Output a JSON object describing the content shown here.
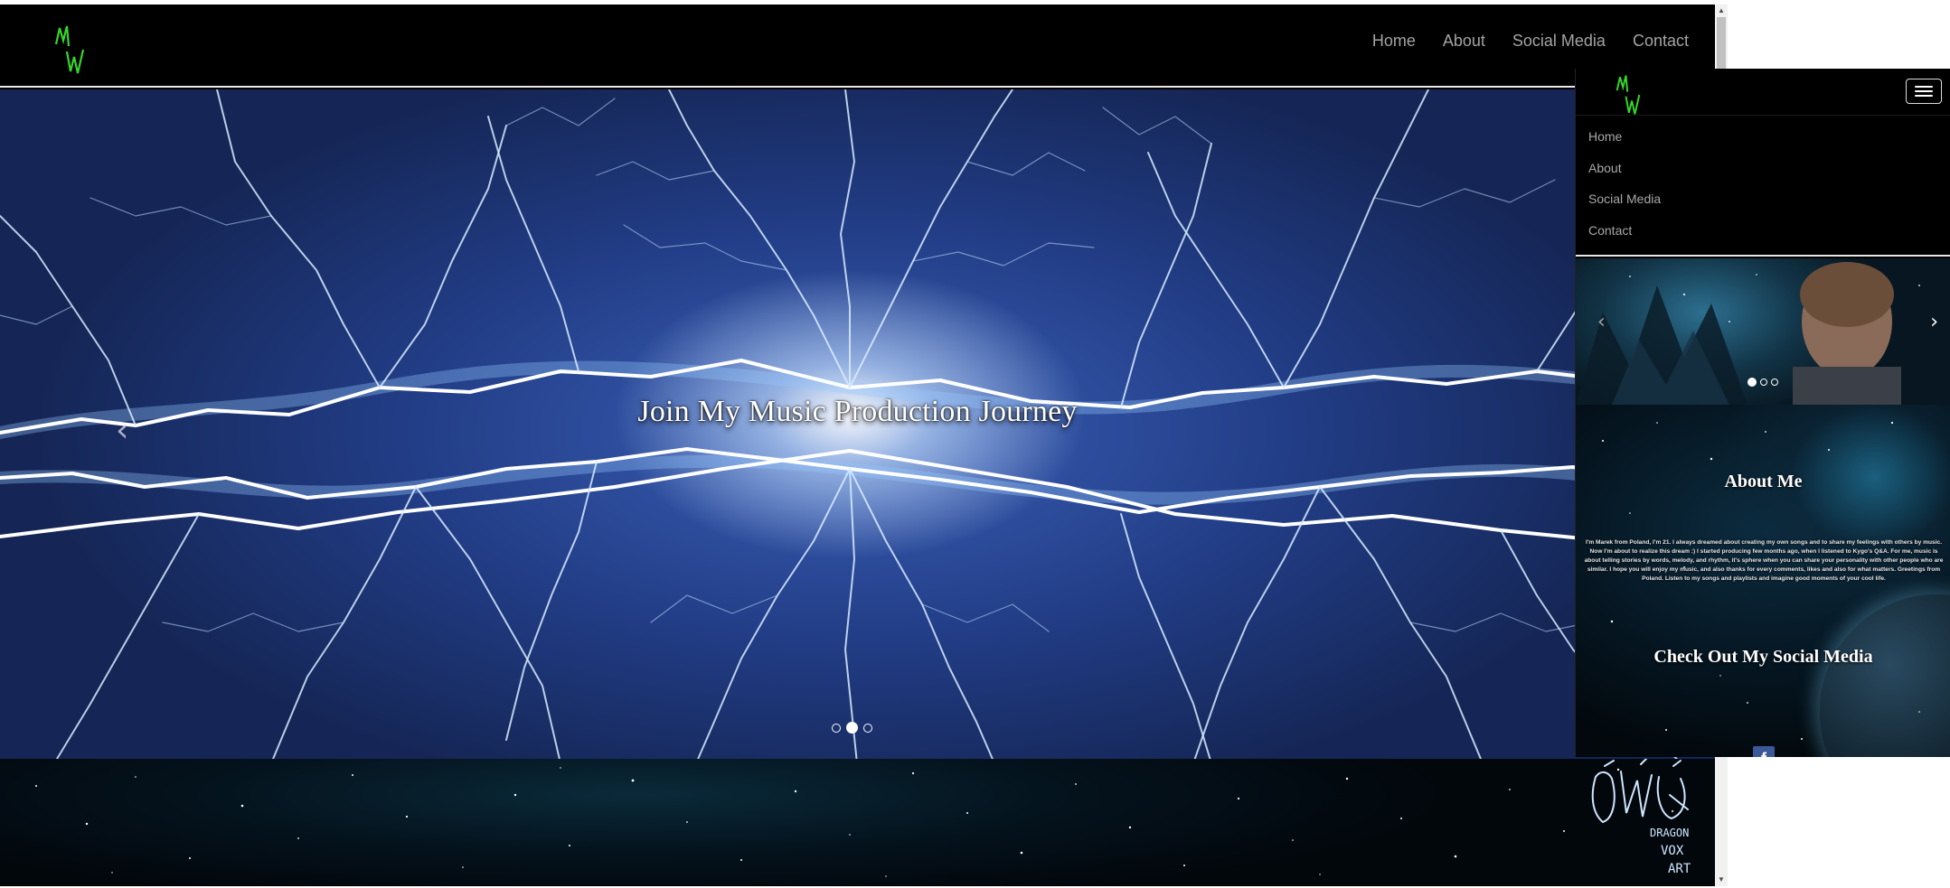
{
  "brand": {
    "logo_text": "MW",
    "logo_color": "#35d62b"
  },
  "main_nav": {
    "items": [
      {
        "label": "Home"
      },
      {
        "label": "About"
      },
      {
        "label": "Social Media"
      },
      {
        "label": "Contact"
      }
    ]
  },
  "hero": {
    "caption": "Join My Music Production Journey",
    "prev_glyph": "‹",
    "slides_count": 3,
    "active_slide": 2
  },
  "footer_logo": {
    "icon": "dragon-vox-art-logo",
    "text_line1": "DRAGON",
    "text_line2": "VOX",
    "text_line3": "ART"
  },
  "mobile": {
    "menu": {
      "items": [
        {
          "label": "Home"
        },
        {
          "label": "About"
        },
        {
          "label": "Social Media"
        },
        {
          "label": "Contact"
        }
      ]
    },
    "carousel": {
      "prev_glyph": "‹",
      "next_glyph": "›",
      "active_slide": 1
    },
    "about": {
      "title": "About Me",
      "text": "I'm Marek from Poland, I'm 21. I always dreamed about creating my own songs and to share my feelings with others by music. Now I'm about to realize this dream :) I started producing few months ago, when I listened to Kygo's Q&A. For me, music is about telling stories by words, melody, and rhythm, it's sphere when you can share your personality with other people who are similar. I hope you will enjoy my music, and also thanks for every comments, likes and also for what matters. Greetings from Poland. Listen to my songs and playlists and imagine good moments of your cool life."
    },
    "social": {
      "title": "Check Out My Social Media",
      "facebook_glyph": "f"
    }
  },
  "colors": {
    "nav_bg": "#000000",
    "nav_link": "#a3a3a3",
    "facebook": "#3b5998"
  }
}
